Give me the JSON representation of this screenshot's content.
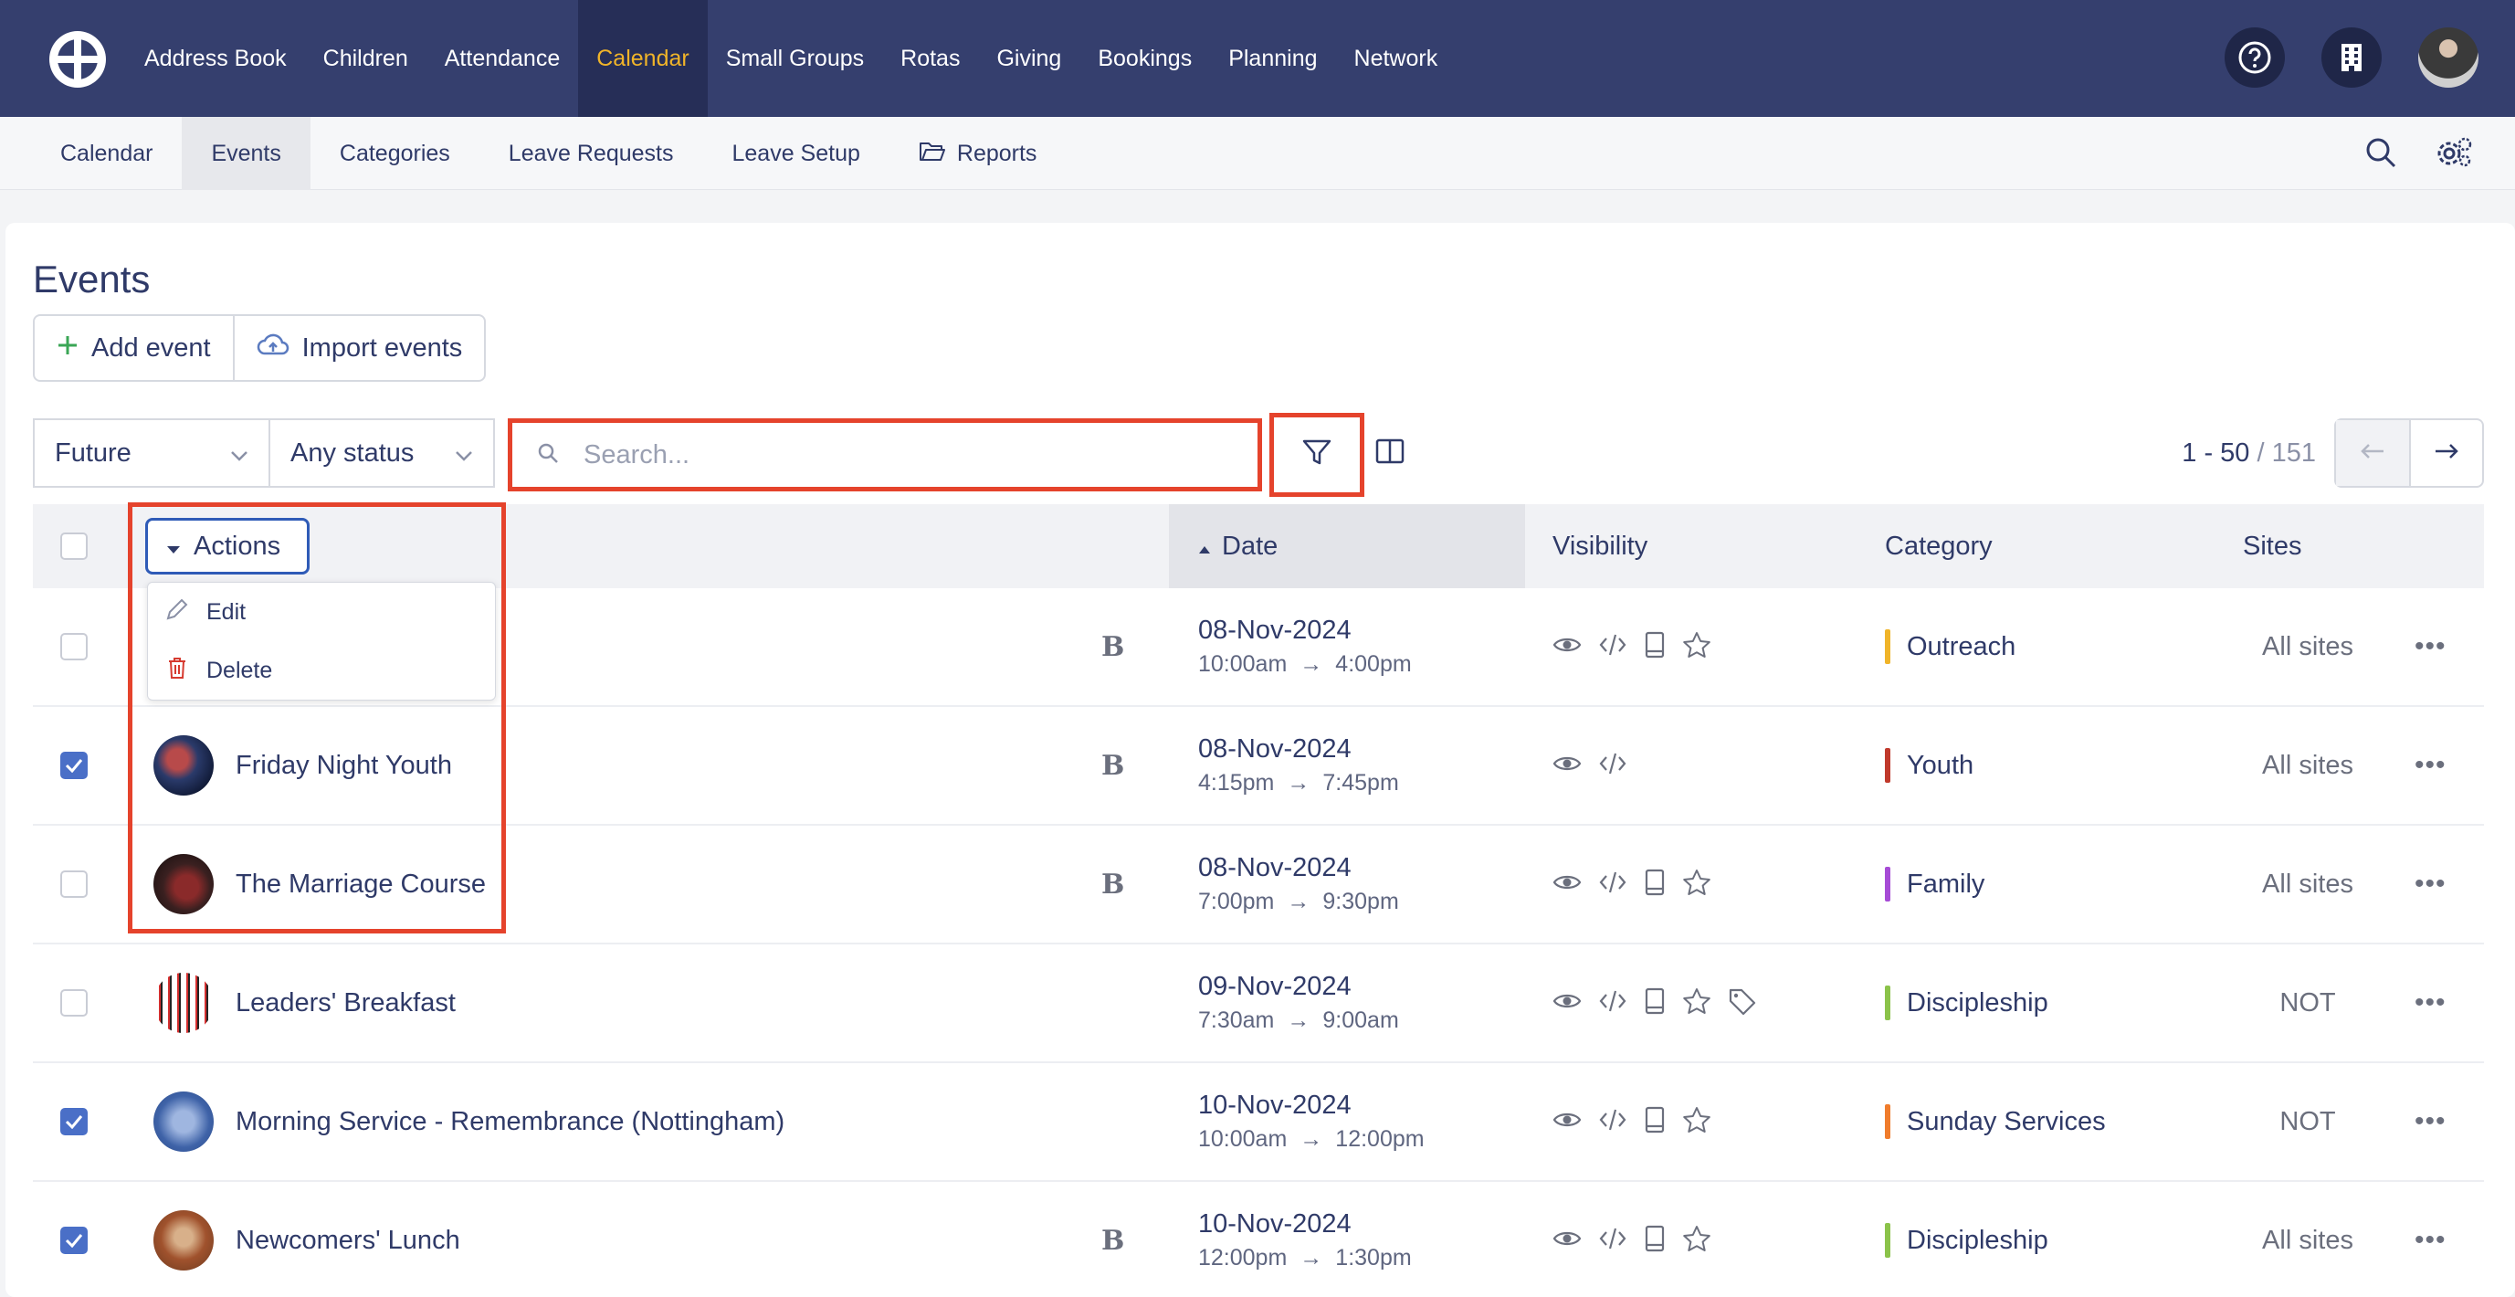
{
  "topnav": {
    "items": [
      "Address Book",
      "Children",
      "Attendance",
      "Calendar",
      "Small Groups",
      "Rotas",
      "Giving",
      "Bookings",
      "Planning",
      "Network"
    ],
    "active": "Calendar",
    "accent_color": "#f0b429",
    "bg_color": "#353f6e"
  },
  "subnav": {
    "items": [
      "Calendar",
      "Events",
      "Categories",
      "Leave Requests",
      "Leave Setup",
      "Reports"
    ],
    "active": "Events"
  },
  "page": {
    "title": "Events",
    "add_event": "Add event",
    "import_events": "Import events"
  },
  "filters": {
    "time": "Future",
    "status": "Any status",
    "search_placeholder": "Search..."
  },
  "pager": {
    "range": "1 - 50",
    "total": "/ 151"
  },
  "table": {
    "headers": {
      "actions": "Actions",
      "date": "Date",
      "visibility": "Visibility",
      "category": "Category",
      "sites": "Sites"
    },
    "actions_menu": [
      "Edit",
      "Delete"
    ],
    "rows": [
      {
        "name": "",
        "checked": false,
        "bold": true,
        "date": "08-Nov-2024",
        "start": "10:00am",
        "end": "4:00pm",
        "vis": [
          "eye",
          "code",
          "tablet",
          "star"
        ],
        "category": "Outreach",
        "cat_color": "#f0b429",
        "sites": "All sites"
      },
      {
        "name": "Friday Night Youth",
        "checked": true,
        "bold": true,
        "date": "08-Nov-2024",
        "start": "4:15pm",
        "end": "7:45pm",
        "vis": [
          "eye",
          "code"
        ],
        "category": "Youth",
        "cat_color": "#c0392b",
        "sites": "All sites"
      },
      {
        "name": "The Marriage Course",
        "checked": false,
        "bold": true,
        "date": "08-Nov-2024",
        "start": "7:00pm",
        "end": "9:30pm",
        "vis": [
          "eye",
          "code",
          "tablet",
          "star"
        ],
        "category": "Family",
        "cat_color": "#a64bd6",
        "sites": "All sites"
      },
      {
        "name": "Leaders' Breakfast",
        "checked": false,
        "bold": false,
        "date": "09-Nov-2024",
        "start": "7:30am",
        "end": "9:00am",
        "vis": [
          "eye",
          "code",
          "tablet",
          "star",
          "tag"
        ],
        "category": "Discipleship",
        "cat_color": "#8bc34a",
        "sites": "NOT"
      },
      {
        "name": "Morning Service - Remembrance (Nottingham)",
        "checked": true,
        "bold": false,
        "date": "10-Nov-2024",
        "start": "10:00am",
        "end": "12:00pm",
        "vis": [
          "eye",
          "code",
          "tablet",
          "star"
        ],
        "category": "Sunday Services",
        "cat_color": "#f07c2c",
        "sites": "NOT"
      },
      {
        "name": "Newcomers' Lunch",
        "checked": true,
        "bold": true,
        "date": "10-Nov-2024",
        "start": "12:00pm",
        "end": "1:30pm",
        "vis": [
          "eye",
          "code",
          "tablet",
          "star"
        ],
        "category": "Discipleship",
        "cat_color": "#8bc34a",
        "sites": "All sites"
      }
    ]
  }
}
